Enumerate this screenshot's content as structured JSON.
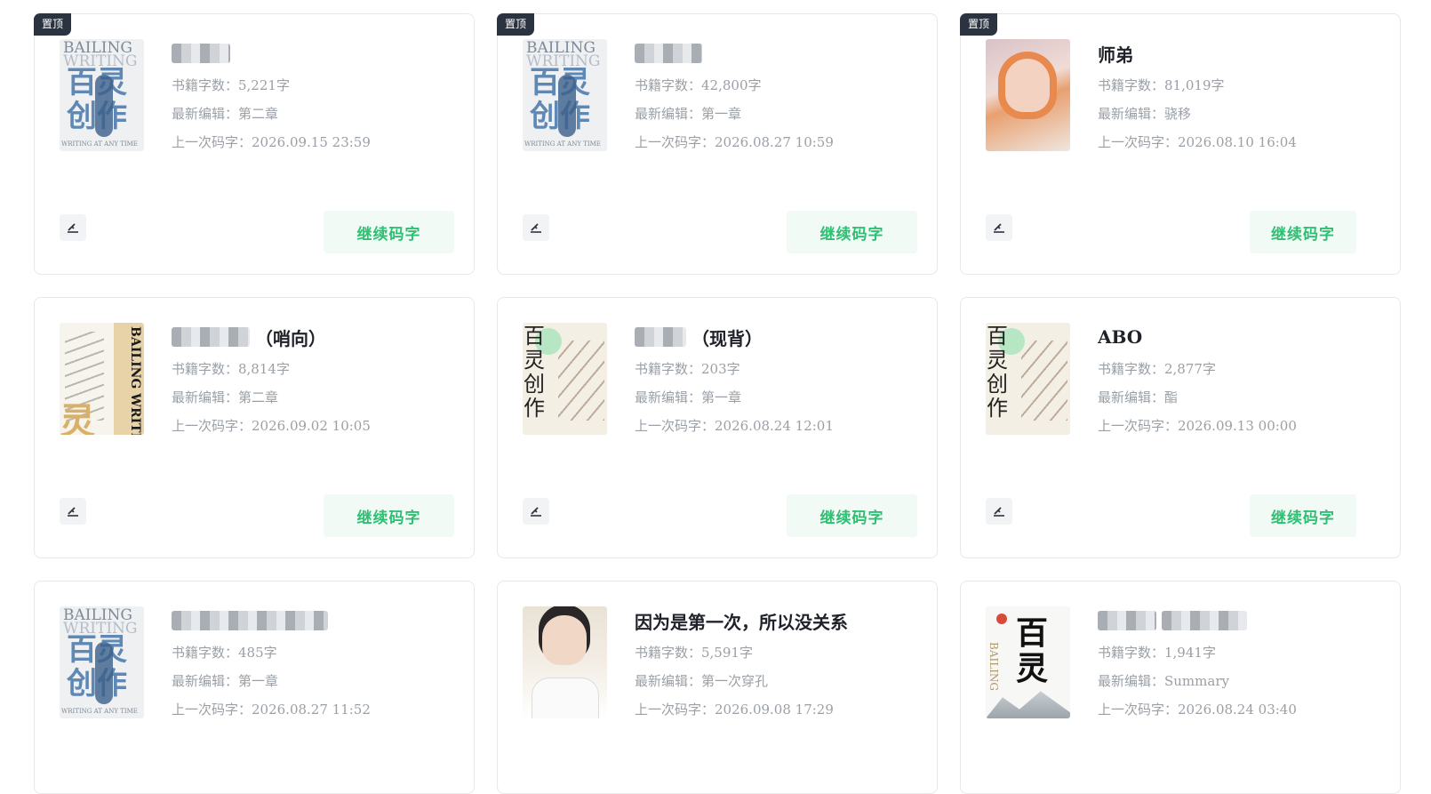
{
  "pin_label": "置顶",
  "cta_label": "继续码字",
  "colors": {
    "accent": "#2fbf73",
    "accent_bg": "#f1faf5",
    "pin_bg": "#2c3340"
  },
  "cards": [
    {
      "pinned": true,
      "title": "",
      "title_suffix": "",
      "words": "书籍字数：5,221字",
      "latest": "最新编辑：第二章",
      "last": "上一次码字：2026.09.15 23:59"
    },
    {
      "pinned": true,
      "title": "",
      "title_suffix": "",
      "words": "书籍字数：42,800字",
      "latest": "最新编辑：第一章",
      "last": "上一次码字：2026.08.27 10:59"
    },
    {
      "pinned": true,
      "title": "师弟",
      "title_suffix": "",
      "words": "书籍字数：81,019字",
      "latest": "最新编辑：骁移",
      "last": "上一次码字：2026.08.10 16:04"
    },
    {
      "pinned": false,
      "title": "",
      "title_suffix": "（哨向）",
      "words": "书籍字数：8,814字",
      "latest": "最新编辑：第二章",
      "last": "上一次码字：2026.09.02 10:05"
    },
    {
      "pinned": false,
      "title": "",
      "title_suffix": "（现背）",
      "words": "书籍字数：203字",
      "latest": "最新编辑：第一章",
      "last": "上一次码字：2026.08.24 12:01"
    },
    {
      "pinned": false,
      "title": "ABO",
      "title_suffix": "",
      "words": "书籍字数：2,877字",
      "latest": "最新编辑：酯",
      "last": "上一次码字：2026.09.13 00:00"
    },
    {
      "pinned": false,
      "title": "",
      "title_suffix": "",
      "words": "书籍字数：485字",
      "latest": "最新编辑：第一章",
      "last": "上一次码字：2026.08.27 11:52"
    },
    {
      "pinned": false,
      "title": "因为是第一次，所以没关系",
      "title_suffix": "",
      "words": "书籍字数：5,591字",
      "latest": "最新编辑：第一次穿孔",
      "last": "上一次码字：2026.09.08 17:29"
    },
    {
      "pinned": false,
      "title": "",
      "title_suffix": "",
      "words": "书籍字数：1,941字",
      "latest": "最新编辑：Summary",
      "last": "上一次码字：2026.08.24 03:40"
    }
  ],
  "covers": {
    "bird": {
      "line1": "BAILING",
      "line2": "WRITING",
      "cn": "百灵创作",
      "tag": "WRITING AT ANY TIME"
    },
    "bamboo": {
      "vert": "BAILING WRITING",
      "cn": "灵"
    },
    "plum": {
      "cn": "百灵创作"
    },
    "ink": {
      "cn": "百灵",
      "side": "BAILING"
    }
  }
}
